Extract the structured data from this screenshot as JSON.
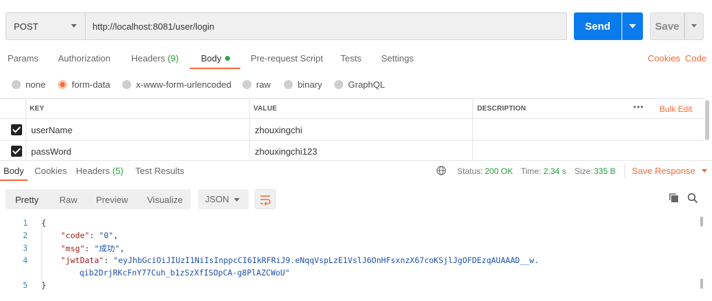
{
  "request": {
    "method": "POST",
    "url": "http://localhost:8081/user/login",
    "send_label": "Send",
    "save_label": "Save"
  },
  "request_tabs": [
    {
      "label": "Params"
    },
    {
      "label": "Authorization"
    },
    {
      "label": "Headers",
      "count": "(9)"
    },
    {
      "label": "Body"
    },
    {
      "label": "Pre-request Script"
    },
    {
      "label": "Tests"
    },
    {
      "label": "Settings"
    }
  ],
  "right_links": {
    "cookies": "Cookies",
    "code": "Code"
  },
  "body_types": [
    {
      "label": "none",
      "selected": false
    },
    {
      "label": "form-data",
      "selected": true
    },
    {
      "label": "x-www-form-urlencoded",
      "selected": false
    },
    {
      "label": "raw",
      "selected": false
    },
    {
      "label": "binary",
      "selected": false
    },
    {
      "label": "GraphQL",
      "selected": false
    }
  ],
  "params_table": {
    "headers": {
      "key": "KEY",
      "value": "VALUE",
      "description": "DESCRIPTION",
      "more": "•••",
      "bulk_edit": "Bulk Edit"
    },
    "rows": [
      {
        "checked": true,
        "key": "userName",
        "value": "zhouxingchi",
        "description": ""
      },
      {
        "checked": true,
        "key": "passWord",
        "value": "zhouxingchi123",
        "description": ""
      }
    ]
  },
  "response_tabs": [
    {
      "label": "Body"
    },
    {
      "label": "Cookies"
    },
    {
      "label": "Headers",
      "count": "(5)"
    },
    {
      "label": "Test Results"
    }
  ],
  "response_status": {
    "status_label": "Status:",
    "status_value": "200 OK",
    "time_label": "Time:",
    "time_value": "2.34 s",
    "size_label": "Size:",
    "size_value": "335 B",
    "save_response": "Save Response"
  },
  "view_modes": [
    "Pretty",
    "Raw",
    "Preview",
    "Visualize"
  ],
  "format": "JSON",
  "code_lines": {
    "n1": "1",
    "n2": "2",
    "n3": "3",
    "n4": "4",
    "n5": "5",
    "open": "{",
    "code_key": "\"code\"",
    "code_val": "\"0\"",
    "msg_key": "\"msg\"",
    "msg_val": "\"成功\"",
    "jwt_key": "\"jwtData\"",
    "jwt_val_1": "\"eyJhbGciOiJIUzI1NiIsInppcCI6IkRFRiJ9.eNqqVspLzE1VslJ6OnHFsxnzX67coKSjlJgOFDEzqAUAAAD__w.",
    "jwt_val_2": "qib2DrjRKcFnY77Cuh_b1zSzXfISOpCA-g8PlAZCWoU\"",
    "close": "}"
  },
  "colors": {
    "accent": "#f26b3a",
    "primary": "#097bed",
    "success": "#2a9a3d"
  }
}
